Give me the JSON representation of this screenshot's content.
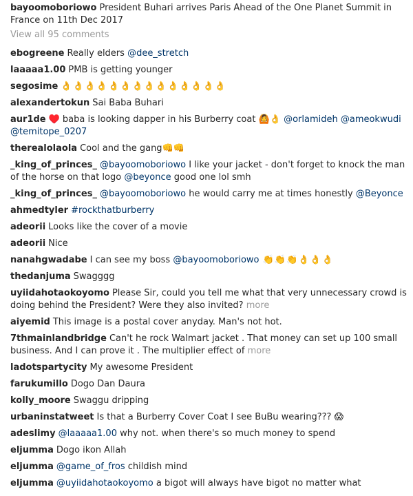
{
  "caption": {
    "username": "bayoomoboriowo",
    "text": "President Buhari arrives Paris Ahead of the One Planet Summit in France on 11th Dec 2017"
  },
  "view_all_comments": "View all 95 comments",
  "comments": [
    {
      "username": "ebogreene",
      "text": "Really elders ",
      "mention": "@dee_stretch"
    },
    {
      "username": "laaaaa1.00",
      "text": "PMB is getting younger"
    },
    {
      "username": "segosime",
      "text": "👌👌👌👌👌👌👌👌👌👌👌👌👌👌"
    },
    {
      "username": "alexandertokun",
      "text": "Sai Baba Buhari"
    },
    {
      "username": "aur1de",
      "text": "♥️ baba is looking dapper in his Burberry coat 🙆👌 ",
      "mention": "@orlamideh @ameokwudi @temitope_0207"
    },
    {
      "username": "therealolaola",
      "text": "Cool and the gang👊👊"
    },
    {
      "username": "_king_of_princes_",
      "mention": "@bayoomoboriowo",
      "text": " I like your jacket - don't forget to knock the man of the horse on that logo ",
      "mention2": "@beyonce",
      "text2": " good one lol smh"
    },
    {
      "username": "_king_of_princes_",
      "mention": "@bayoomoboriowo",
      "text": " he would carry me at times honestly ",
      "mention2": "@Beyonce"
    },
    {
      "username": "ahmedtyler",
      "mention": "#rockthatburberry"
    },
    {
      "username": "adeorii",
      "text": "Looks like the cover of a movie"
    },
    {
      "username": "adeorii",
      "text": "Nice"
    },
    {
      "username": "nanahgwadabe",
      "text": "I can see my boss ",
      "mention": "@bayoomoboriowo",
      "text2": " 👏👏👏👌👌👌"
    },
    {
      "username": "thedanjuma",
      "text": "Swagggg"
    },
    {
      "username": "uyiidahotaokoyomo",
      "text": "Please Sir, could you tell me what that very unnecessary crowd is doing behind the President? Were they also invited? ",
      "more": "more"
    },
    {
      "username": "aiyemid",
      "text": "This image is a postal cover anyday. Man's not hot."
    },
    {
      "username": "7thmainlandbridge",
      "text": "Can't he rock Walmart jacket . That money can set up 100 small business. And I can prove it . The multiplier effect of ",
      "more": "more"
    },
    {
      "username": "ladotspartycity",
      "text": "My awesome President"
    },
    {
      "username": "farukumillo",
      "text": "Dogo Dan Daura"
    },
    {
      "username": "kolly_moore",
      "text": "Swaggu dripping"
    },
    {
      "username": "urbaninstatweet",
      "text": "Is that a Burberry Cover Coat I see BuBu wearing??? 😱"
    },
    {
      "username": "adeslimy",
      "mention": "@laaaaa1.00",
      "text": " why not. when there's so much money to spend"
    },
    {
      "username": "eljumma",
      "text": "Dogo ikon Allah"
    },
    {
      "username": "eljumma",
      "mention": "@game_of_fros",
      "text": " childish mind"
    },
    {
      "username": "eljumma",
      "mention": "@uyiidahotaokoyomo",
      "text": " a bigot will always have bigot no matter what"
    }
  ],
  "colors": {
    "username": "#262626",
    "mention": "#003569",
    "muted": "#999999"
  }
}
